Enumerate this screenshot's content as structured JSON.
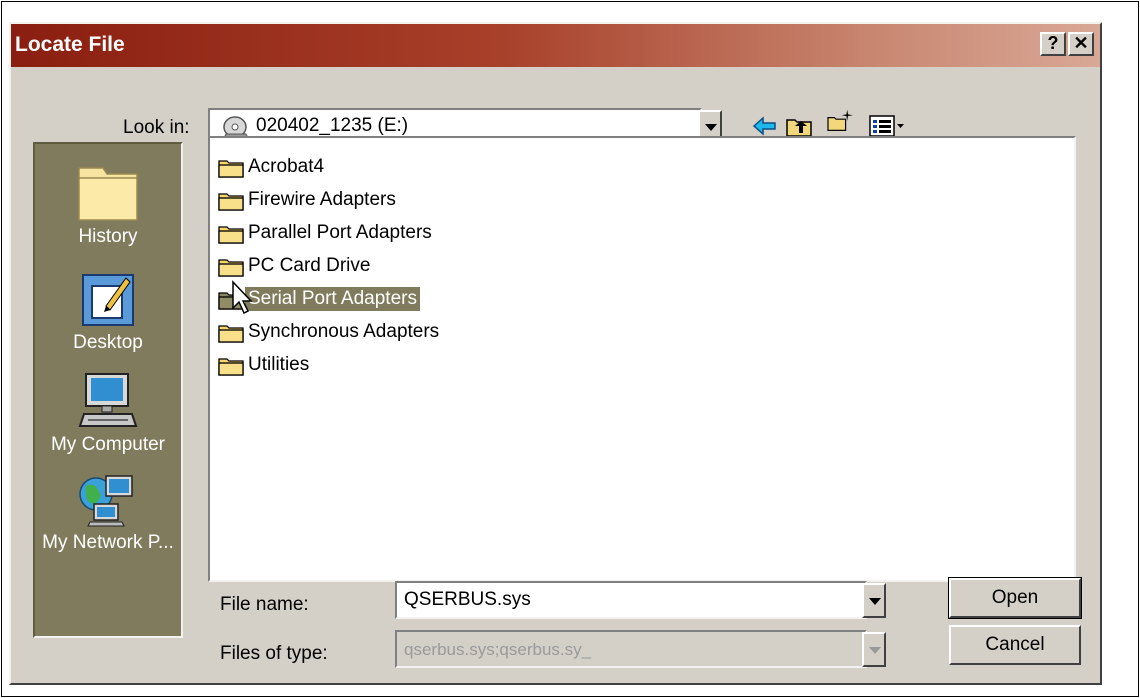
{
  "dialog": {
    "title": "Locate File"
  },
  "titlebar": {
    "help_label": "?",
    "close_label": "✕"
  },
  "look_in": {
    "label": "Look in:",
    "value": "020402_1235 (E:)",
    "icon": "cd-drive-icon"
  },
  "toolbar": {
    "icons": [
      "back-arrow-icon",
      "up-one-level-icon",
      "create-new-folder-icon",
      "view-menu-icon"
    ]
  },
  "places": [
    {
      "label": "History",
      "icon": "history-folder-icon"
    },
    {
      "label": "Desktop",
      "icon": "desktop-icon"
    },
    {
      "label": "My Computer",
      "icon": "my-computer-icon"
    },
    {
      "label": "My Network P...",
      "icon": "network-places-icon"
    }
  ],
  "files": [
    {
      "name": "Acrobat4"
    },
    {
      "name": "Firewire Adapters"
    },
    {
      "name": "Parallel Port Adapters"
    },
    {
      "name": "PC Card Drive"
    },
    {
      "name": "Serial Port Adapters",
      "selected": true
    },
    {
      "name": "Synchronous Adapters"
    },
    {
      "name": "Utilities"
    }
  ],
  "file_name": {
    "label": "File name:",
    "value": "QSERBUS.sys"
  },
  "files_of_type": {
    "label": "Files of type:",
    "value": "qserbus.sys;qserbus.sy_"
  },
  "buttons": {
    "open": "Open",
    "cancel": "Cancel"
  },
  "colors": {
    "title_start": "#8a1e10",
    "title_end": "#d9a896",
    "places_bar": "#807b5c",
    "selection": "#807b5c",
    "face": "#d4d0c8"
  }
}
